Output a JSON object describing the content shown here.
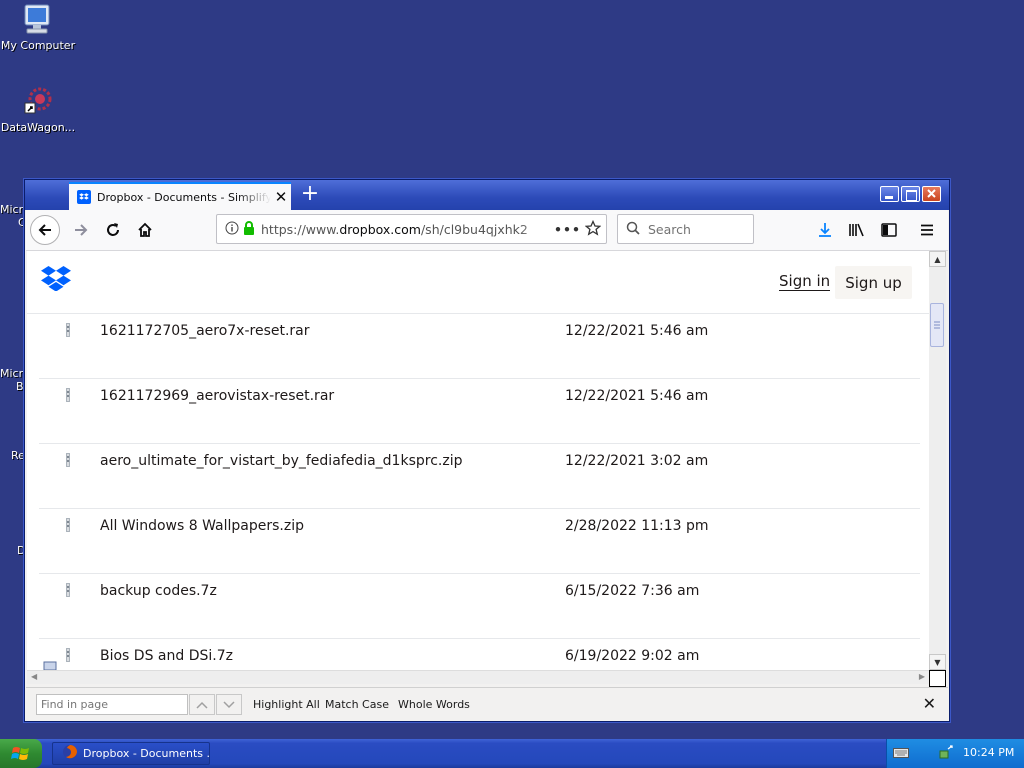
{
  "desktop": {
    "icons": [
      {
        "label": "My Computer"
      },
      {
        "label": "DataWagon..."
      }
    ],
    "partial_labels": [
      "Micro",
      "C",
      "Micro",
      "B",
      "Re",
      "D"
    ]
  },
  "browser": {
    "tab": {
      "title": "Dropbox - Documents - Simplify your life"
    },
    "url": {
      "prefix": "https://www.",
      "host": "dropbox.com",
      "path": "/sh/cl9bu4qjxhk2"
    },
    "search_placeholder": "Search",
    "page": {
      "signin_label": "Sign in",
      "signup_label": "Sign up",
      "files": [
        {
          "name": "1621172705_aero7x-reset.rar",
          "date": "12/22/2021 5:46 am"
        },
        {
          "name": "1621172969_aerovistax-reset.rar",
          "date": "12/22/2021 5:46 am"
        },
        {
          "name": "aero_ultimate_for_vistart_by_fediafedia_d1ksprc.zip",
          "date": "12/22/2021 3:02 am"
        },
        {
          "name": "All Windows 8 Wallpapers.zip",
          "date": "2/28/2022 11:13 pm"
        },
        {
          "name": "backup codes.7z",
          "date": "6/15/2022 7:36 am"
        },
        {
          "name": "Bios DS and DSi.7z",
          "date": "6/19/2022 9:02 am"
        }
      ]
    },
    "findbar": {
      "placeholder": "Find in page",
      "highlight_all": "Highlight All",
      "match_case": "Match Case",
      "whole_words": "Whole Words"
    }
  },
  "taskbar": {
    "task_label": "Dropbox - Documents ...",
    "clock": "10:24 PM"
  },
  "colors": {
    "desktop": "#2e3a85",
    "dropbox_blue": "#0061fe",
    "tab_accent": "#0a84ff"
  }
}
